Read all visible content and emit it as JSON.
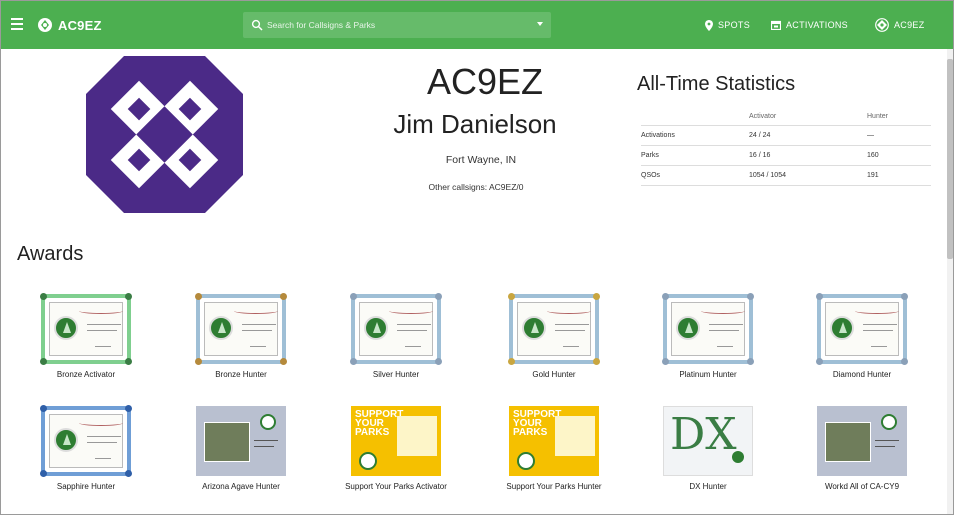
{
  "header": {
    "brand": "AC9EZ",
    "search_placeholder": "Search for Callsigns & Parks",
    "nav": [
      {
        "label": "SPOTS",
        "icon": "map-pin-icon"
      },
      {
        "label": "ACTIVATIONS",
        "icon": "calendar-icon"
      },
      {
        "label": "AC9EZ",
        "icon": "user-badge-icon"
      }
    ],
    "colors": {
      "bar": "#4caf50",
      "search": "#66bb6a"
    }
  },
  "profile": {
    "callsign": "AC9EZ",
    "name": "Jim Danielson",
    "location": "Fort Wayne, IN",
    "other_callsigns": "Other callsigns: AC9EZ/0",
    "logo_colors": {
      "primary": "#4b2a87",
      "secondary": "#ffffff"
    }
  },
  "stats": {
    "title": "All-Time Statistics",
    "columns": [
      "",
      "Activator",
      "Hunter"
    ],
    "rows": [
      [
        "Activations",
        "24 / 24",
        "—"
      ],
      [
        "Parks",
        "16 / 16",
        "160"
      ],
      [
        "QSOs",
        "1054 / 1054",
        "191"
      ]
    ]
  },
  "awards": {
    "title": "Awards",
    "items": [
      {
        "label": "Bronze Activator",
        "style": "cert",
        "border": "#7fcf8f",
        "corner": "#3a7d44"
      },
      {
        "label": "Bronze Hunter",
        "style": "cert",
        "border": "#9fbfd6",
        "corner": "#b58a3c"
      },
      {
        "label": "Silver Hunter",
        "style": "cert",
        "border": "#9fbfd6",
        "corner": "#8aa0b8"
      },
      {
        "label": "Gold Hunter",
        "style": "cert",
        "border": "#9fbfd6",
        "corner": "#c9a640"
      },
      {
        "label": "Platinum Hunter",
        "style": "cert",
        "border": "#9fbfd6",
        "corner": "#8aa0b8"
      },
      {
        "label": "Diamond Hunter",
        "style": "cert",
        "border": "#9fbfd6",
        "corner": "#8aa0b8"
      },
      {
        "label": "Sapphire Hunter",
        "style": "cert",
        "border": "#6f9ed6",
        "corner": "#2f5fa8"
      },
      {
        "label": "Arizona Agave Hunter",
        "style": "photo"
      },
      {
        "label": "Support Your Parks Activator",
        "style": "yellow",
        "big_text": "SUPPORT YOUR PARKS"
      },
      {
        "label": "Support Your Parks Hunter",
        "style": "yellow",
        "big_text": "SUPPORT YOUR PARKS"
      },
      {
        "label": "DX Hunter",
        "style": "dx",
        "big_text": "DX"
      },
      {
        "label": "Workd All of CA-CY9",
        "style": "photo"
      }
    ]
  }
}
